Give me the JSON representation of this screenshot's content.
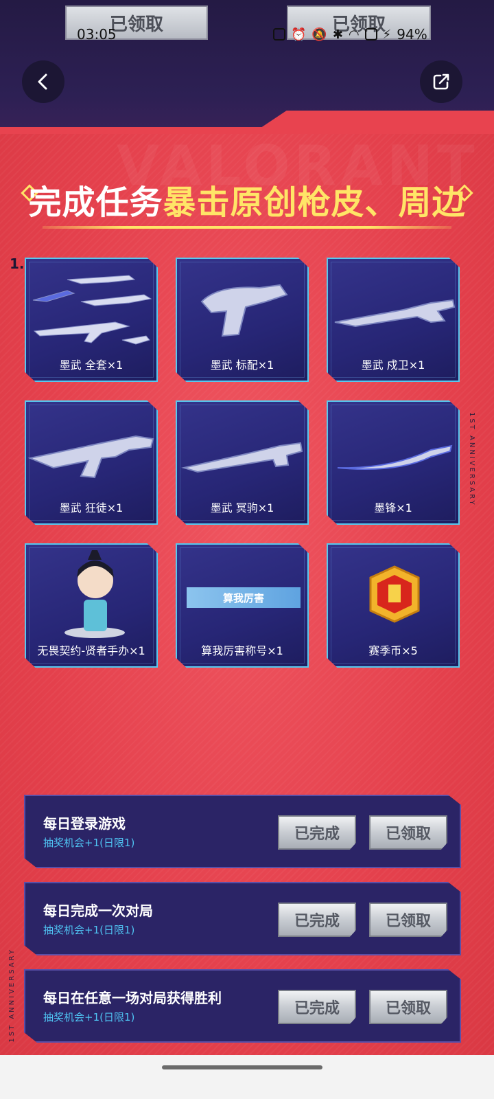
{
  "status_bar": {
    "time": "03:05",
    "battery": "94%",
    "ghost_tabs": [
      "已领取",
      "已领取"
    ]
  },
  "nav": {
    "back": "back-icon",
    "share": "share-icon"
  },
  "title": {
    "white": "完成任务",
    "yellow": "暴击原创枪皮、周边"
  },
  "section_index": "1.",
  "watermark": "VALORANT",
  "side_text": "1ST ANNIVERSARY",
  "rewards": [
    {
      "label": "墨武 全套×1"
    },
    {
      "label": "墨武 标配×1"
    },
    {
      "label": "墨武 戍卫×1"
    },
    {
      "label": "墨武 狂徒×1"
    },
    {
      "label": "墨武 冥驹×1"
    },
    {
      "label": "墨锋×1"
    },
    {
      "label": "无畏契约-贤者手办×1"
    },
    {
      "label": "算我厉害称号×1",
      "banner": "算我厉害"
    },
    {
      "label": "赛季币×5"
    }
  ],
  "tasks": [
    {
      "title": "每日登录游戏",
      "subtitle": "抽奖机会+1(日限1)",
      "done": "已完成",
      "claim": "已领取"
    },
    {
      "title": "每日完成一次对局",
      "subtitle": "抽奖机会+1(日限1)",
      "done": "已完成",
      "claim": "已领取"
    },
    {
      "title": "每日在任意一场对局获得胜利",
      "subtitle": "抽奖机会+1(日限1)",
      "done": "已完成",
      "claim": "已领取"
    }
  ],
  "colors": {
    "accent_yellow": "#ffe567",
    "accent_cyan": "#4fc3f2",
    "bg_red": "#e8434f"
  }
}
